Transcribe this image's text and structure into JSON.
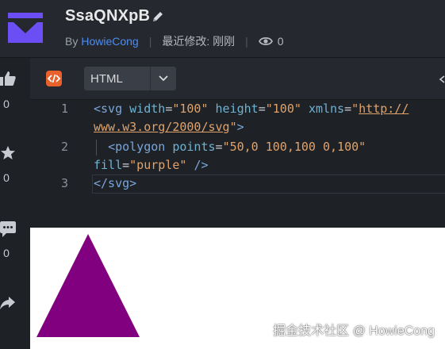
{
  "header": {
    "title": "SsaQNXpB",
    "by_label": "By",
    "author": "HowieCong",
    "updated": "最近修改: 刚刚",
    "views": "0"
  },
  "sidebar": {
    "like_count": "0",
    "star_count": "0",
    "comment_count": "0"
  },
  "toolbar": {
    "language": "HTML"
  },
  "editor": {
    "line_numbers": [
      "1",
      "2",
      "3"
    ]
  },
  "watermark": "掘金技术社区 @ HowieCong",
  "colors": {
    "accent_purple": "#800080",
    "logo_purple": "#6c4ff4",
    "code_badge": "#e8612c",
    "author_link": "#4d8df0"
  }
}
